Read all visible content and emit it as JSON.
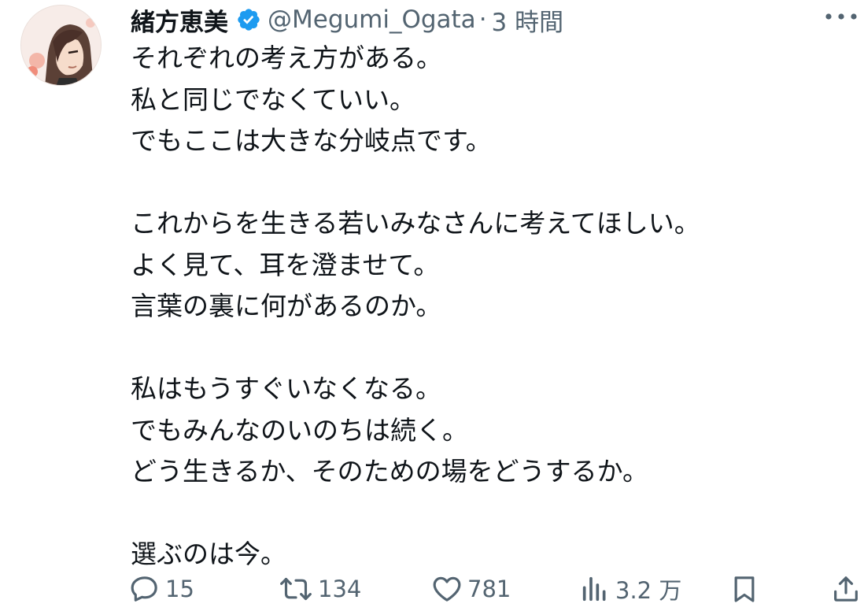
{
  "author": {
    "display_name": "緒方恵美",
    "handle": "@Megumi_Ogata",
    "separator": "·",
    "time": "3 時間",
    "verified": true
  },
  "icons": {
    "verified": "verified-badge-icon",
    "more": "more-icon",
    "reply": "reply-icon",
    "retweet": "retweet-icon",
    "like": "like-icon",
    "views": "views-icon",
    "bookmark": "bookmark-icon",
    "share": "share-icon"
  },
  "colors": {
    "text": "#0f1419",
    "secondary": "#536471",
    "verified": "#1d9bf0",
    "background": "#ffffff"
  },
  "tweet": {
    "lines": [
      "それぞれの考え方がある。",
      "私と同じでなくていい。",
      "でもここは大きな分岐点です。",
      "",
      "これからを生きる若いみなさんに考えてほしい。",
      "よく見て、耳を澄ませて。",
      "言葉の裏に何があるのか。",
      "",
      "私はもうすぐいなくなる。",
      "でもみんなのいのちは続く。",
      "どう生きるか、そのための場をどうするか。",
      "",
      "選ぶのは今。"
    ]
  },
  "actions": {
    "replies": "15",
    "retweets": "134",
    "likes": "781",
    "views": "3.2 万"
  }
}
